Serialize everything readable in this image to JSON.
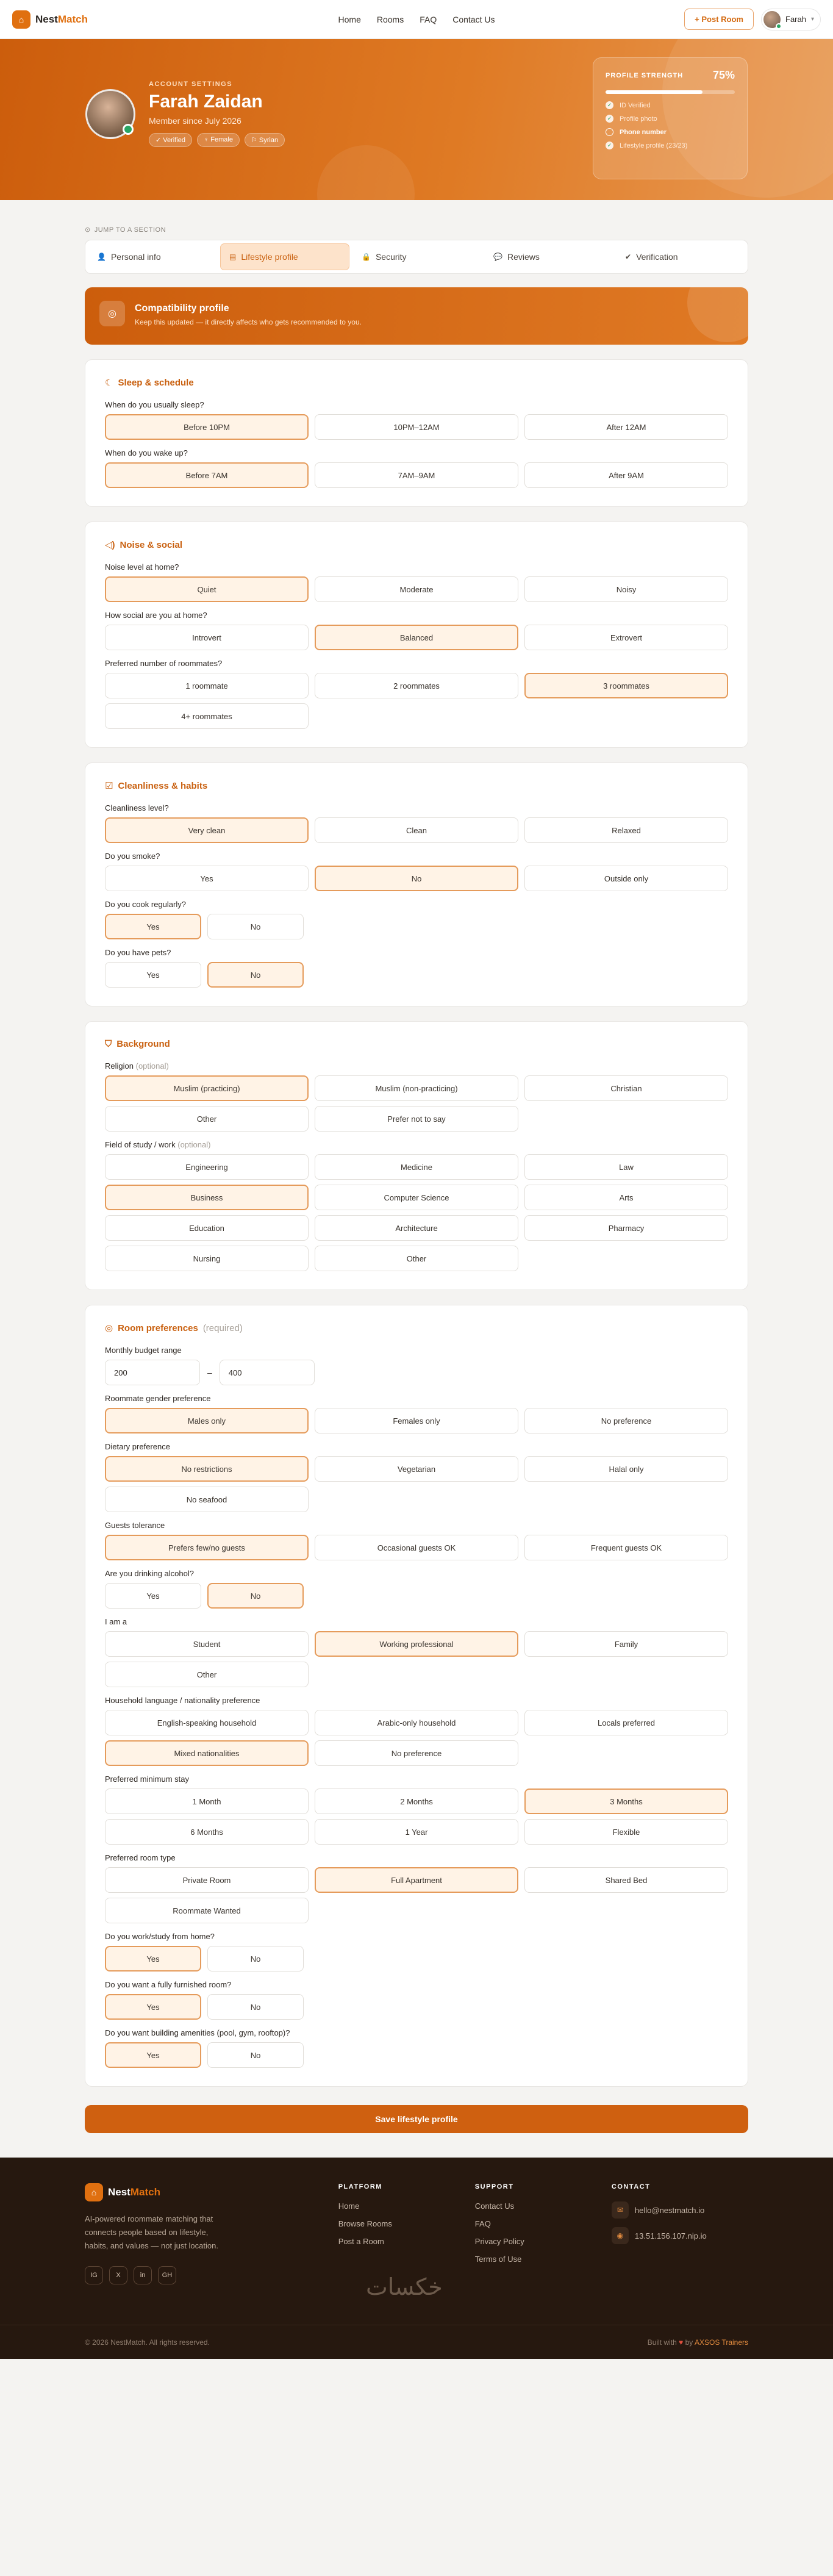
{
  "nav": {
    "brand_a": "Nest",
    "brand_b": "Match",
    "links": [
      "Home",
      "Rooms",
      "FAQ",
      "Contact Us"
    ],
    "post": "+ Post Room",
    "user": "Farah"
  },
  "hero": {
    "eyebrow": "ACCOUNT SETTINGS",
    "name": "Farah Zaidan",
    "since": "Member since July 2026",
    "badges": [
      "Verified",
      "Female",
      "Syrian"
    ]
  },
  "strength": {
    "title": "PROFILE STRENGTH",
    "percent": "75%",
    "value": 0.75,
    "items": [
      {
        "label": "ID Verified",
        "done": true
      },
      {
        "label": "Profile photo",
        "done": true
      },
      {
        "label": "Phone number",
        "done": false
      },
      {
        "label": "Lifestyle profile (23/23)",
        "done": true
      }
    ]
  },
  "jump": "JUMP TO A SECTION",
  "tabs": [
    "Personal info",
    "Lifestyle profile",
    "Security",
    "Reviews",
    "Verification"
  ],
  "compat": {
    "title": "Compatibility profile",
    "subtitle": "Keep this updated — it directly affects who gets recommended to you."
  },
  "sections": [
    {
      "title": "Sleep & schedule",
      "icon": "moon-icon",
      "questions": [
        {
          "q": "When do you usually sleep?",
          "layout": "grid",
          "options": [
            "Before 10PM",
            "10PM–12AM",
            "After 12AM"
          ],
          "sel": [
            0
          ]
        },
        {
          "q": "When do you wake up?",
          "layout": "grid",
          "options": [
            "Before 7AM",
            "7AM–9AM",
            "After 9AM"
          ],
          "sel": [
            0
          ]
        }
      ]
    },
    {
      "title": "Noise & social",
      "icon": "sound-icon",
      "questions": [
        {
          "q": "Noise level at home?",
          "layout": "grid",
          "options": [
            "Quiet",
            "Moderate",
            "Noisy"
          ],
          "sel": [
            0
          ]
        },
        {
          "q": "How social are you at home?",
          "layout": "grid",
          "options": [
            "Introvert",
            "Balanced",
            "Extrovert"
          ],
          "sel": [
            1
          ]
        },
        {
          "q": "Preferred number of roommates?",
          "layout": "grid",
          "options": [
            "1 roommate",
            "2 roommates",
            "3 roommates",
            "4+ roommates"
          ],
          "sel": [
            2
          ]
        }
      ]
    },
    {
      "title": "Cleanliness & habits",
      "icon": "checklist-icon",
      "questions": [
        {
          "q": "Cleanliness level?",
          "layout": "grid",
          "options": [
            "Very clean",
            "Clean",
            "Relaxed"
          ],
          "sel": [
            0
          ]
        },
        {
          "q": "Do you smoke?",
          "layout": "grid",
          "options": [
            "Yes",
            "No",
            "Outside only"
          ],
          "sel": [
            1
          ]
        },
        {
          "q": "Do you cook regularly?",
          "layout": "yn",
          "options": [
            "Yes",
            "No"
          ],
          "sel": [
            0
          ]
        },
        {
          "q": "Do you have pets?",
          "layout": "yn",
          "options": [
            "Yes",
            "No"
          ],
          "sel": [
            1
          ]
        }
      ]
    },
    {
      "title": "Background",
      "icon": "shield-icon",
      "questions": [
        {
          "q": "Religion",
          "q_opt": "(optional)",
          "layout": "grid",
          "options": [
            "Muslim (practicing)",
            "Muslim (non-practicing)",
            "Christian",
            "Other",
            "Prefer not to say"
          ],
          "sel": [
            0
          ]
        },
        {
          "q": "Field of study / work",
          "q_opt": "(optional)",
          "layout": "grid",
          "options": [
            "Engineering",
            "Medicine",
            "Law",
            "Business",
            "Computer Science",
            "Arts",
            "Education",
            "Architecture",
            "Pharmacy",
            "Nursing",
            "Other"
          ],
          "sel": [
            3
          ]
        }
      ]
    },
    {
      "title": "Room preferences",
      "title_opt": "(required)",
      "icon": "target-icon",
      "budget": {
        "label": "Monthly budget range",
        "min": "200",
        "dash": "–",
        "max": "400"
      },
      "questions": [
        {
          "q": "Roommate gender preference",
          "layout": "grid",
          "options": [
            "Males only",
            "Females only",
            "No preference"
          ],
          "sel": [
            0
          ]
        },
        {
          "q": "Dietary preference",
          "layout": "grid",
          "options": [
            "No restrictions",
            "Vegetarian",
            "Halal only",
            "No seafood"
          ],
          "sel": [
            0
          ]
        },
        {
          "q": "Guests tolerance",
          "layout": "grid",
          "options": [
            "Prefers few/no guests",
            "Occasional guests OK",
            "Frequent guests OK"
          ],
          "sel": [
            0
          ]
        },
        {
          "q": "Are you drinking alcohol?",
          "layout": "yn",
          "options": [
            "Yes",
            "No"
          ],
          "sel": [
            1
          ]
        },
        {
          "q": "I am a",
          "layout": "grid",
          "options": [
            "Student",
            "Working professional",
            "Family",
            "Other"
          ],
          "sel": [
            1
          ]
        },
        {
          "q": "Household language / nationality preference",
          "layout": "grid",
          "options": [
            "English-speaking household",
            "Arabic-only household",
            "Locals preferred",
            "Mixed nationalities",
            "No preference"
          ],
          "sel": [
            3
          ]
        },
        {
          "q": "Preferred minimum stay",
          "layout": "grid",
          "options": [
            "1 Month",
            "2 Months",
            "3 Months",
            "6 Months",
            "1 Year",
            "Flexible"
          ],
          "sel": [
            2
          ]
        },
        {
          "q": "Preferred room type",
          "layout": "grid",
          "options": [
            "Private Room",
            "Full Apartment",
            "Shared Bed",
            "Roommate Wanted"
          ],
          "sel": [
            1
          ]
        },
        {
          "q": "Do you work/study from home?",
          "layout": "yn",
          "options": [
            "Yes",
            "No"
          ],
          "sel": [
            0
          ]
        },
        {
          "q": "Do you want a fully furnished room?",
          "layout": "yn",
          "options": [
            "Yes",
            "No"
          ],
          "sel": [
            0
          ]
        },
        {
          "q": "Do you want building amenities (pool, gym, rooftop)?",
          "layout": "yn",
          "options": [
            "Yes",
            "No"
          ],
          "sel": [
            0
          ]
        }
      ]
    }
  ],
  "save": "Save lifestyle profile",
  "footer": {
    "desc": "AI-powered roommate matching that connects people based on lifestyle, habits, and values — not just location.",
    "socials": [
      "IG",
      "X",
      "in",
      "GH"
    ],
    "platform": {
      "h": "PLATFORM",
      "links": [
        "Home",
        "Browse Rooms",
        "Post a Room"
      ]
    },
    "support": {
      "h": "SUPPORT",
      "links": [
        "Contact Us",
        "FAQ",
        "Privacy Policy",
        "Terms of Use"
      ]
    },
    "contact": {
      "h": "CONTACT",
      "email": "hello@nestmatch.io",
      "ip": "13.51.156.107.nip.io"
    },
    "copy": "© 2026 NestMatch. All rights reserved.",
    "built_a": "Built with",
    "built_b": "by",
    "built_c": "AXSOS Trainers",
    "arabic": "خكسات"
  }
}
